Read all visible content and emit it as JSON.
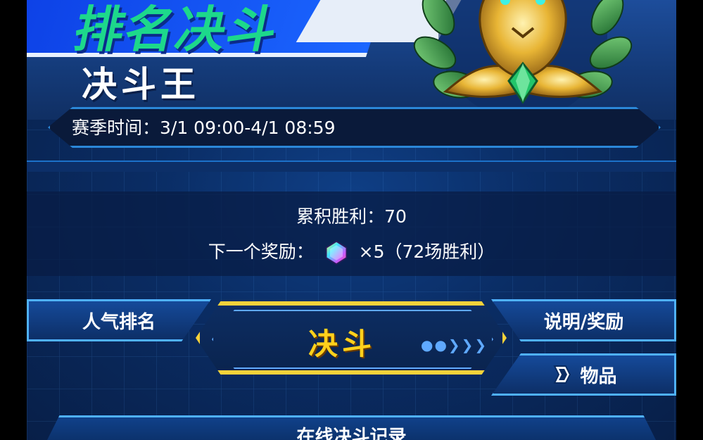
{
  "header": {
    "banner_text": "排名决斗",
    "rank_title": "决斗王",
    "season_time": "赛季时间：3/1 09:00-4/1 08:59"
  },
  "stats": {
    "cumulative_wins": "累积胜利：70",
    "next_reward_label": "下一个奖励：",
    "next_reward_detail": "×5（72场胜利）",
    "reward_icon": "crystal-gem-icon"
  },
  "buttons": {
    "popularity_ranking": "人气排名",
    "duel": "决斗",
    "explanation_rewards": "说明/奖励",
    "items": "物品",
    "items_icon": "card-pack-icon"
  },
  "footer": {
    "online_duel_record": "在线决斗记录"
  },
  "colors": {
    "accent_yellow": "#f7d23a",
    "panel_blue": "#0a2c63",
    "border_blue": "#4fb1ff",
    "banner_green": "#1dd88b"
  }
}
